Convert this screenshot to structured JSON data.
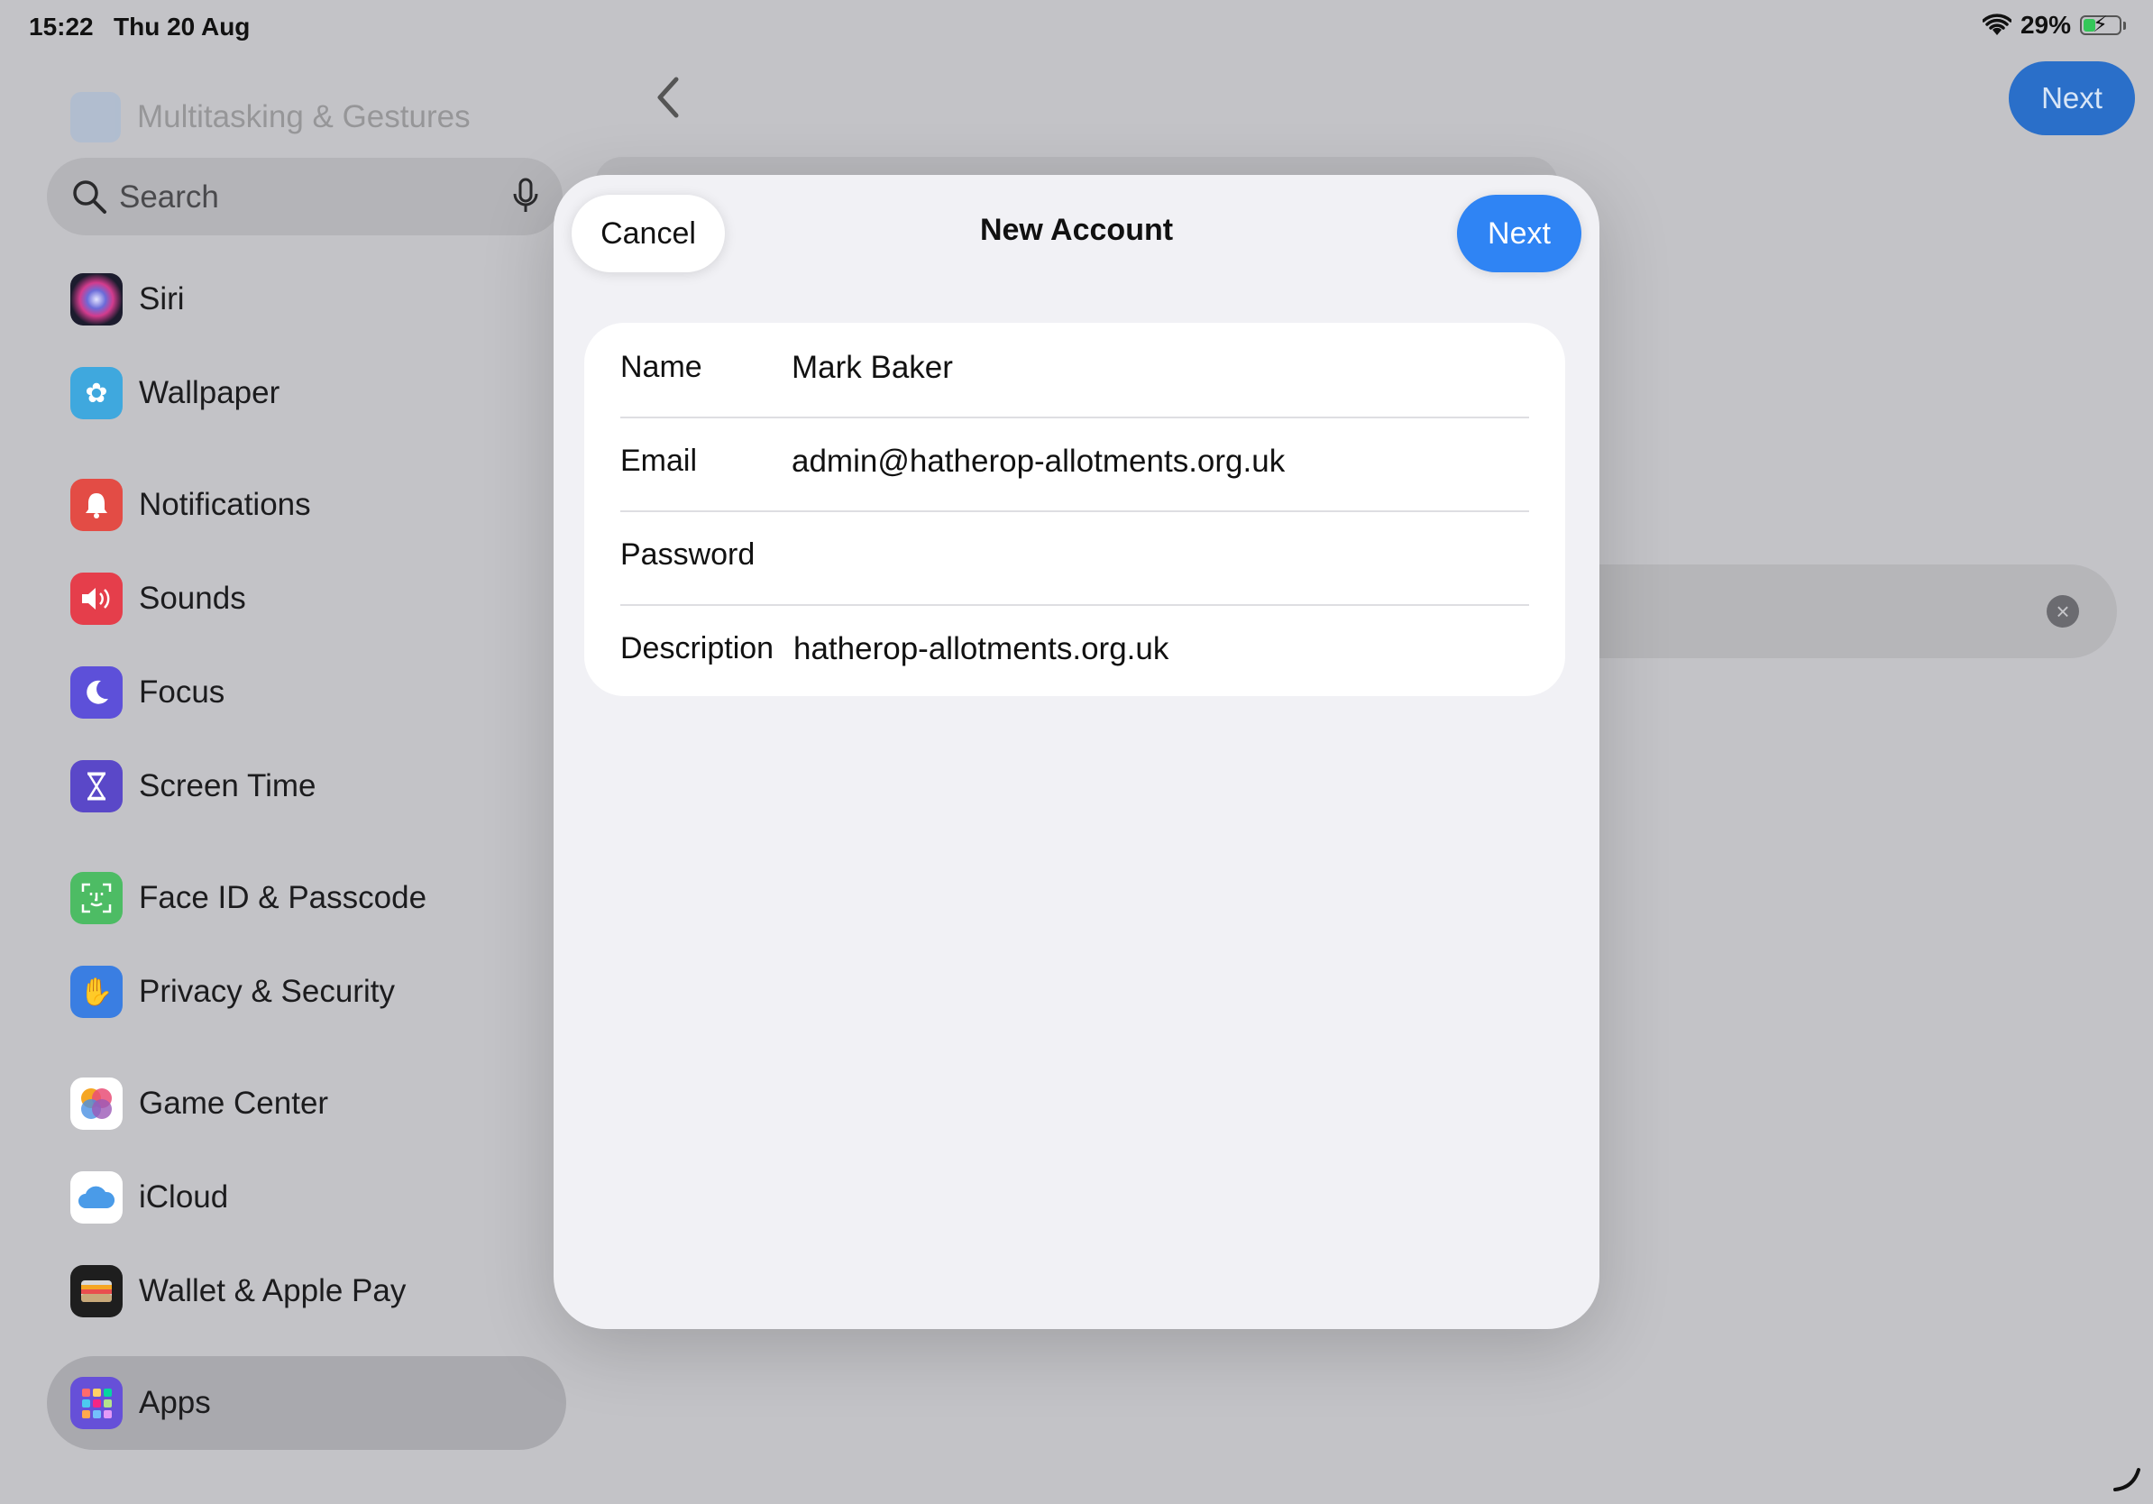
{
  "status_bar": {
    "time": "15:22",
    "date": "Thu 20 Aug",
    "battery": "29%"
  },
  "sidebar": {
    "faded_item": "Multitasking & Gestures",
    "search": {
      "placeholder": "Search"
    },
    "items": [
      {
        "label": "Siri",
        "icon": "siri-icon",
        "color": "#2b1f4a"
      },
      {
        "label": "Wallpaper",
        "icon": "wallpaper-flower-icon",
        "color": "#36a4d9"
      },
      {
        "label": "Notifications",
        "icon": "bell-icon",
        "color": "#e84a45"
      },
      {
        "label": "Sounds",
        "icon": "speaker-icon",
        "color": "#e8414d"
      },
      {
        "label": "Focus",
        "icon": "moon-icon",
        "color": "#5b4fd6"
      },
      {
        "label": "Screen Time",
        "icon": "hourglass-icon",
        "color": "#5a48c8"
      },
      {
        "label": "Face ID & Passcode",
        "icon": "face-id-icon",
        "color": "#4cbb63"
      },
      {
        "label": "Privacy & Security",
        "icon": "hand-icon",
        "color": "#3b7ee0"
      },
      {
        "label": "Game Center",
        "icon": "game-center-icon",
        "color": "#ffffff"
      },
      {
        "label": "iCloud",
        "icon": "cloud-icon",
        "color": "#ffffff"
      },
      {
        "label": "Wallet & Apple Pay",
        "icon": "wallet-icon",
        "color": "#1e1e1e"
      },
      {
        "label": "Apps",
        "icon": "apps-grid-icon",
        "color": "#6650d8"
      }
    ]
  },
  "background": {
    "next_label": "Next"
  },
  "modal": {
    "title": "New Account",
    "cancel_label": "Cancel",
    "next_label": "Next",
    "fields": [
      {
        "label": "Name",
        "value": "Mark Baker"
      },
      {
        "label": "Email",
        "value": "admin@hatherop-allotments.org.uk"
      },
      {
        "label": "Password",
        "value": ""
      },
      {
        "label": "Description",
        "value": "hatherop-allotments.org.uk"
      }
    ]
  },
  "colors": {
    "accent": "#2f84f4",
    "dimmed_accent": "#2a6fc9"
  }
}
